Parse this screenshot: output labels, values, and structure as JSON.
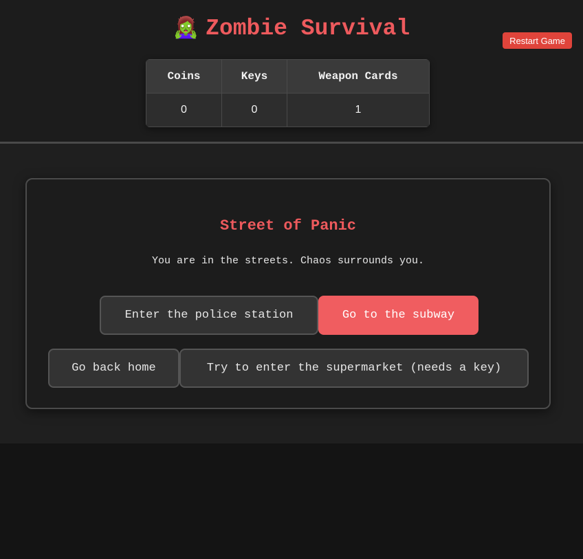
{
  "header": {
    "emoji": "🧟‍♀️",
    "title": "Zombie Survival",
    "restart_label": "Restart Game"
  },
  "stats": {
    "headers": [
      "Coins",
      "Keys",
      "Weapon Cards"
    ],
    "values": [
      "0",
      "0",
      "1"
    ]
  },
  "scene": {
    "title": "Street of Panic",
    "description": "You are in the streets. Chaos surrounds you.",
    "choices": [
      "Enter the police station",
      "Go to the subway",
      "Go back home",
      "Try to enter the supermarket (needs a key)"
    ]
  },
  "colors": {
    "accent": "#ee5a5d",
    "restart_button": "#e0443b",
    "background": "#1c1c1c"
  }
}
